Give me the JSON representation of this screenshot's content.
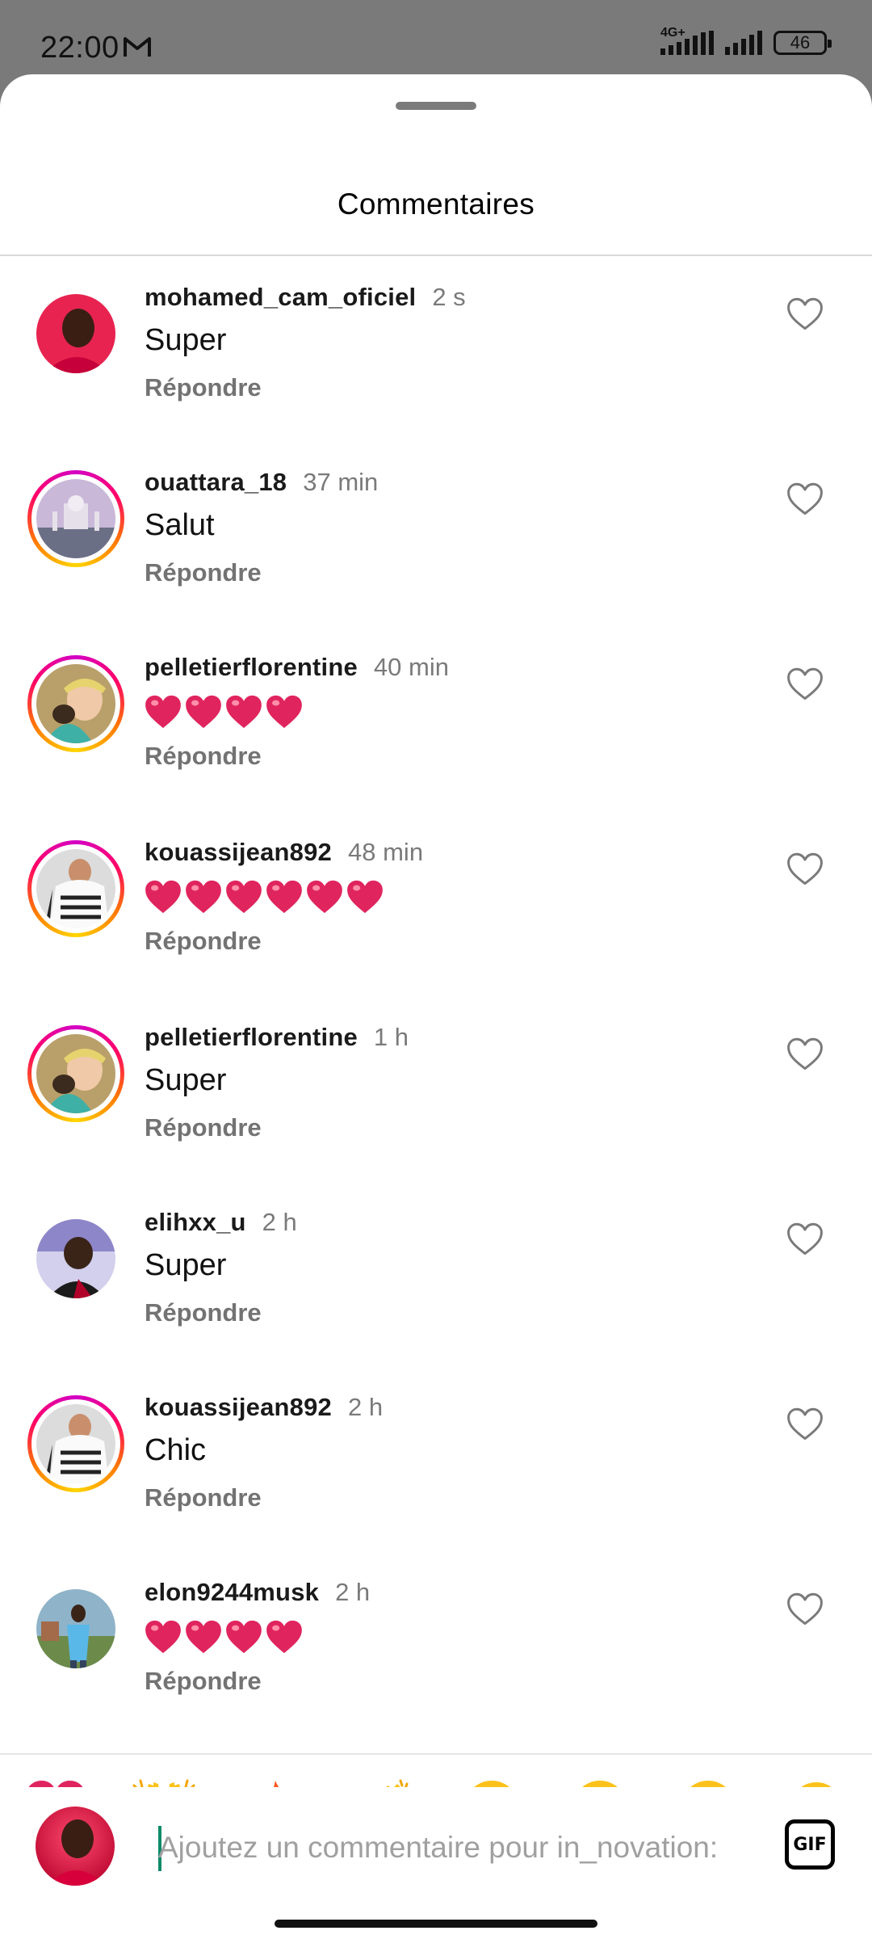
{
  "status_bar": {
    "time": "22:00",
    "network": "4G+",
    "battery": "46"
  },
  "sheet": {
    "title": "Commentaires"
  },
  "comments": [
    {
      "username": "mohamed_cam_oficiel",
      "time": "2 s",
      "text": "Super",
      "hearts": 0,
      "reply": "Répondre",
      "story_ring": false
    },
    {
      "username": "ouattara_18",
      "time": "37 min",
      "text": "Salut",
      "hearts": 0,
      "reply": "Répondre",
      "story_ring": true
    },
    {
      "username": "pelletierflorentine",
      "time": "40 min",
      "text": "❤️❤️❤️❤️",
      "hearts": 4,
      "reply": "Répondre",
      "story_ring": true
    },
    {
      "username": "kouassijean892",
      "time": "48 min",
      "text": "❤️❤️❤️❤️❤️❤️",
      "hearts": 6,
      "reply": "Répondre",
      "story_ring": true
    },
    {
      "username": "pelletierflorentine",
      "time": "1 h",
      "text": "Super",
      "hearts": 0,
      "reply": "Répondre",
      "story_ring": true
    },
    {
      "username": "elihxx_u",
      "time": "2 h",
      "text": "Super",
      "hearts": 0,
      "reply": "Répondre",
      "story_ring": false
    },
    {
      "username": "kouassijean892",
      "time": "2 h",
      "text": "Chic",
      "hearts": 0,
      "reply": "Répondre",
      "story_ring": true
    },
    {
      "username": "elon9244musk",
      "time": "2 h",
      "text": "❤️❤️❤️❤️",
      "hearts": 4,
      "reply": "Répondre",
      "story_ring": false
    }
  ],
  "emoji_bar": [
    "red-heart",
    "raising-hands",
    "fire",
    "clapping-hands",
    "crying-face",
    "heart-eyes-face",
    "surprised-face",
    "tears-of-joy-face"
  ],
  "input": {
    "placeholder": "Ajoutez un commentaire pour in_novation:",
    "gif_label": "GIF"
  },
  "colors": {
    "heart": "#e0245e",
    "username": "#1a1a1a",
    "muted": "#737373"
  }
}
